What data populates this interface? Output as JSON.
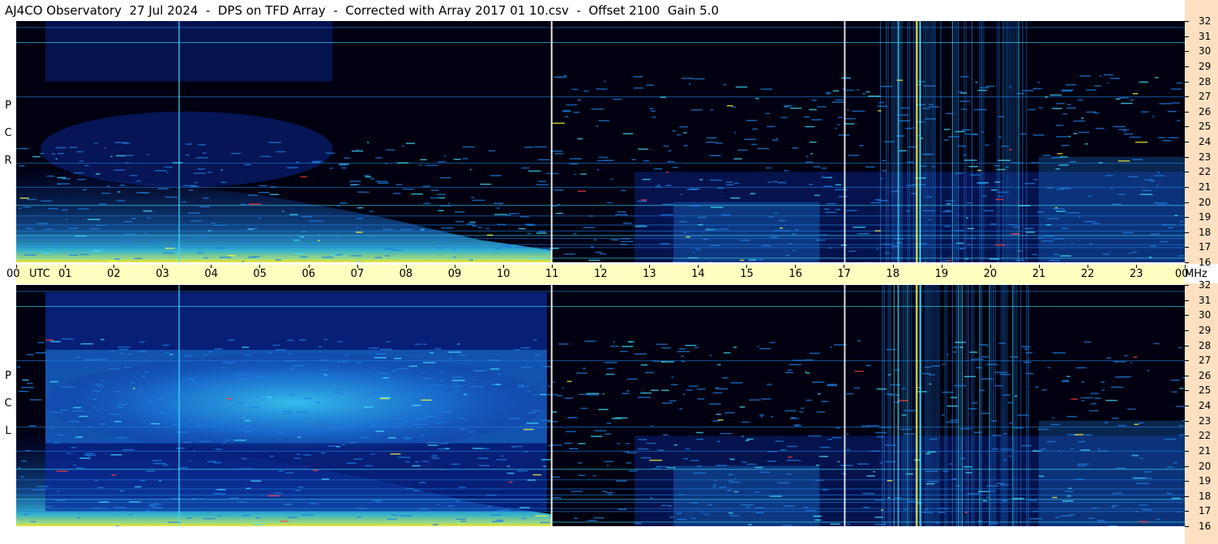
{
  "window": {
    "title": "AJ4CO Observatory  27 Jul 2024  -  DPS on TFD Array  -  Corrected with Array 2017 01 10.csv  -  Offset 2100  Gain 5.0"
  },
  "labels": {
    "rcp": [
      "R",
      "C",
      "P"
    ],
    "lcp": [
      "L",
      "C",
      "P"
    ]
  },
  "chart_data": [
    {
      "type": "heatmap",
      "polarization": "RCP",
      "x_unit": "UTC",
      "y_unit": "MHz",
      "x_range": [
        0,
        24
      ],
      "y_range": [
        16,
        32
      ],
      "x_ticks": [
        "00",
        "01",
        "02",
        "03",
        "04",
        "05",
        "06",
        "07",
        "08",
        "09",
        "10",
        "11",
        "12",
        "13",
        "14",
        "15",
        "16",
        "17",
        "18",
        "19",
        "20",
        "21",
        "22",
        "23",
        "00"
      ],
      "y_ticks": [
        "16",
        "17",
        "18",
        "19",
        "20",
        "21",
        "22",
        "23",
        "24",
        "25",
        "26",
        "27",
        "28",
        "29",
        "30",
        "31",
        "32"
      ]
    },
    {
      "type": "heatmap",
      "polarization": "LCP",
      "x_unit": "UTC",
      "y_unit": "MHz",
      "x_range": [
        0,
        24
      ],
      "y_range": [
        16,
        32
      ],
      "x_ticks": [
        "00",
        "01",
        "02",
        "03",
        "04",
        "05",
        "06",
        "07",
        "08",
        "09",
        "10",
        "11",
        "12",
        "13",
        "14",
        "15",
        "16",
        "17",
        "18",
        "19",
        "20",
        "21",
        "22",
        "23",
        "00"
      ],
      "y_ticks": [
        "16",
        "17",
        "18",
        "19",
        "20",
        "21",
        "22",
        "23",
        "24",
        "25",
        "26",
        "27",
        "28",
        "29",
        "30",
        "31",
        "32"
      ]
    }
  ],
  "time_axis": {
    "utc_label": "UTC",
    "mhz_label": "MHz"
  },
  "colors": {
    "background": "#000010",
    "low": "#0a2a9a",
    "mid": "#1e7de0",
    "high": "#40e0ff",
    "peak": "#ffff40",
    "axis_time_bg": "#ffffc0",
    "axis_freq_bg": "#ffe0c0"
  }
}
